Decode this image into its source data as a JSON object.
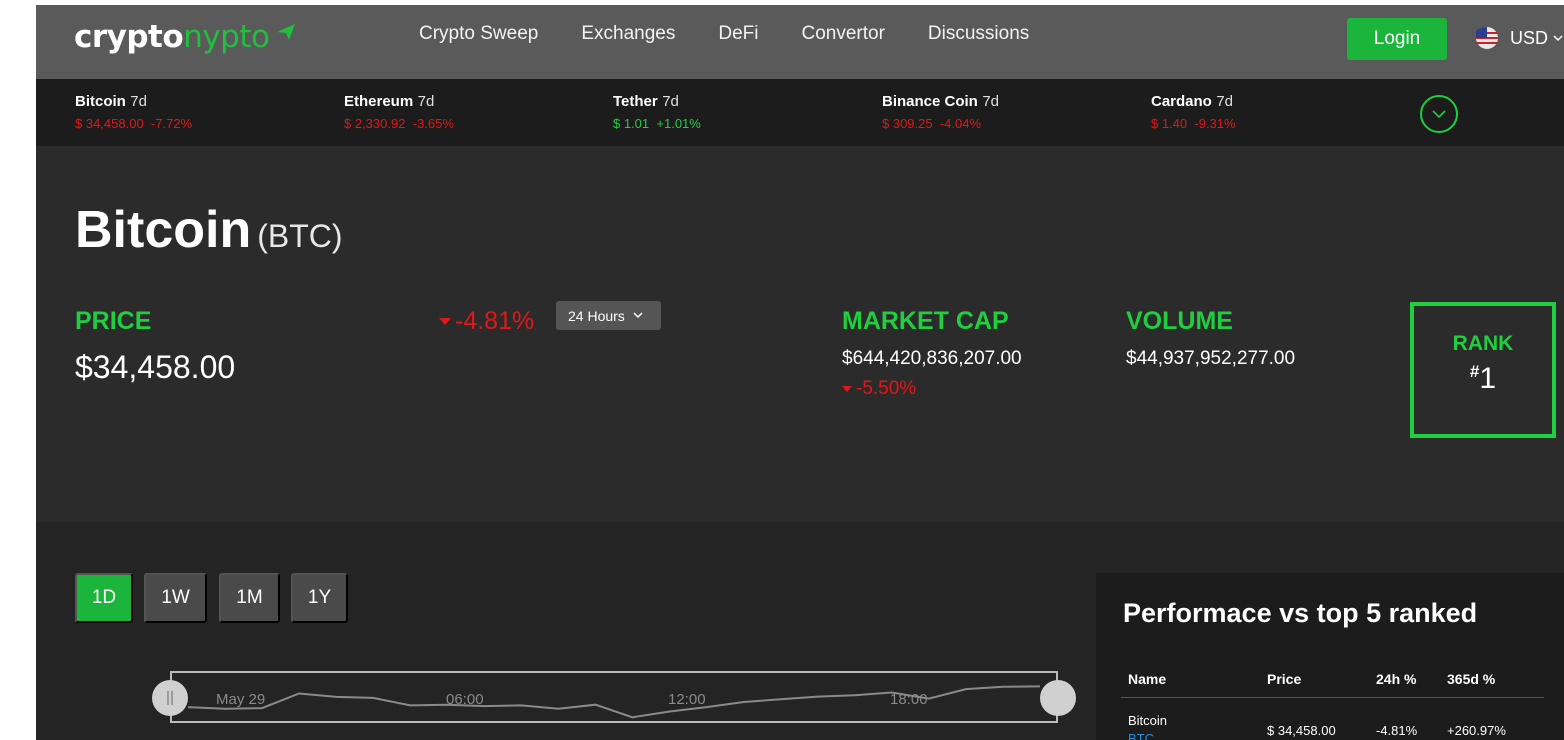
{
  "brand": {
    "part1": "crypto",
    "part2": "nypto"
  },
  "nav": {
    "links": [
      "Crypto Sweep",
      "Exchanges",
      "DeFi",
      "Convertor",
      "Discussions"
    ],
    "login_label": "Login",
    "currency": "USD"
  },
  "ticker": [
    {
      "name": "Bitcoin",
      "period": "7d",
      "price": "$ 34,458.00",
      "change": "-7.72%",
      "direction": "down"
    },
    {
      "name": "Ethereum",
      "period": "7d",
      "price": "$ 2,330.92",
      "change": "-3.65%",
      "direction": "down"
    },
    {
      "name": "Tether",
      "period": "7d",
      "price": "$ 1.01",
      "change": "+1.01%",
      "direction": "up"
    },
    {
      "name": "Binance Coin",
      "period": "7d",
      "price": "$ 309.25",
      "change": "-4.04%",
      "direction": "down"
    },
    {
      "name": "Cardano",
      "period": "7d",
      "price": "$ 1.40",
      "change": "-9.31%",
      "direction": "down"
    }
  ],
  "coin": {
    "name": "Bitcoin",
    "symbol": "(BTC)",
    "price_label": "PRICE",
    "price": "$34,458.00",
    "price_change": "-4.81%",
    "period": "24 Hours",
    "market_cap_label": "MARKET CAP",
    "market_cap": "$644,420,836,207.00",
    "market_cap_change": "-5.50%",
    "volume_label": "VOLUME",
    "volume": "$44,937,952,277.00",
    "rank_label": "RANK",
    "rank_hash": "#",
    "rank": "1"
  },
  "ranges": [
    "1D",
    "1W",
    "1M",
    "1Y"
  ],
  "active_range": "1D",
  "chart": {
    "x_labels": [
      "May 29",
      "06:00",
      "12:00",
      "18:00"
    ],
    "line_values": [
      0.35,
      0.3,
      0.32,
      0.75,
      0.65,
      0.62,
      0.4,
      0.42,
      0.38,
      0.4,
      0.3,
      0.42,
      0.05,
      0.22,
      0.35,
      0.5,
      0.58,
      0.66,
      0.7,
      0.78,
      0.6,
      0.88,
      0.95,
      0.96
    ]
  },
  "performance": {
    "title": "Performace vs top 5 ranked",
    "headers": [
      "Name",
      "Price",
      "24h %",
      "365d %"
    ],
    "rows": [
      {
        "name": "Bitcoin",
        "symbol": "BTC",
        "price": "$ 34,458.00",
        "d24": "-4.81%",
        "d365": "+260.97%"
      }
    ]
  },
  "colors": {
    "accent": "#1fcf3f",
    "negative": "#e01818",
    "bg": "#2b2b2b",
    "nav": "#5a5a5a"
  }
}
